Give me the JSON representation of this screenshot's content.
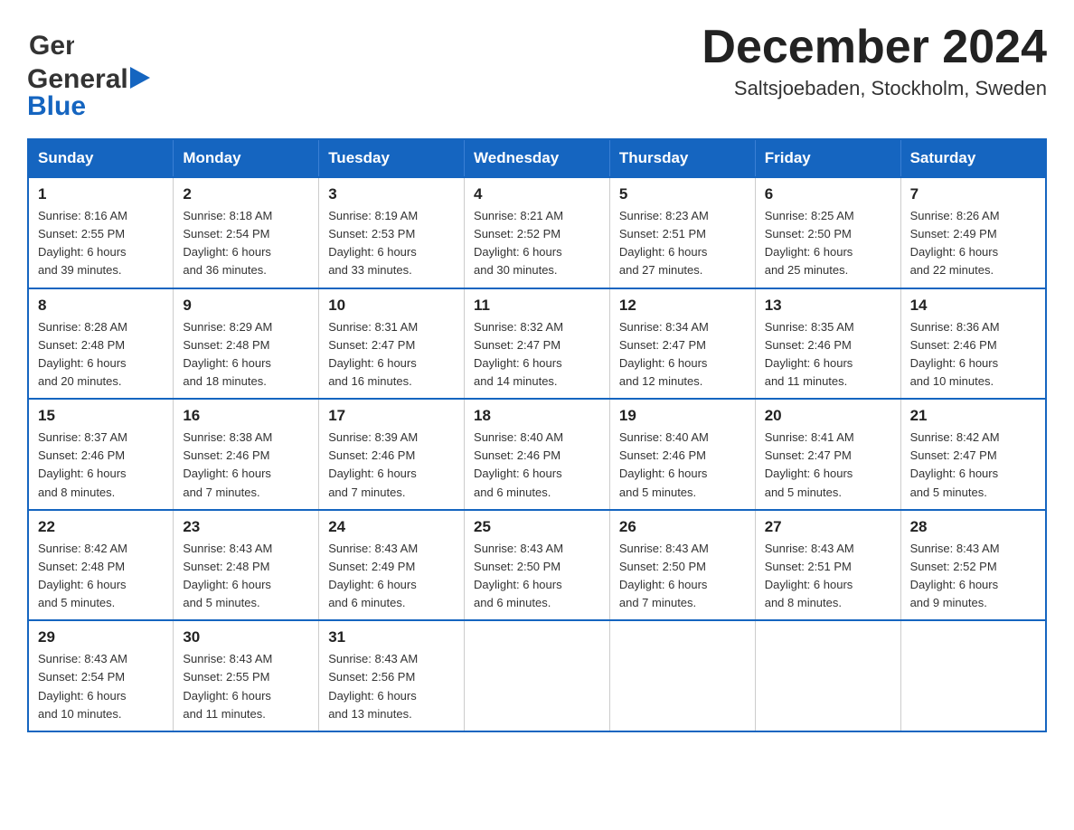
{
  "header": {
    "logo_line1": "General",
    "logo_line2": "Blue",
    "month_title": "December 2024",
    "subtitle": "Saltsjoebaden, Stockholm, Sweden"
  },
  "weekdays": [
    "Sunday",
    "Monday",
    "Tuesday",
    "Wednesday",
    "Thursday",
    "Friday",
    "Saturday"
  ],
  "weeks": [
    [
      {
        "day": "1",
        "sunrise": "8:16 AM",
        "sunset": "2:55 PM",
        "daylight": "6 hours and 39 minutes."
      },
      {
        "day": "2",
        "sunrise": "8:18 AM",
        "sunset": "2:54 PM",
        "daylight": "6 hours and 36 minutes."
      },
      {
        "day": "3",
        "sunrise": "8:19 AM",
        "sunset": "2:53 PM",
        "daylight": "6 hours and 33 minutes."
      },
      {
        "day": "4",
        "sunrise": "8:21 AM",
        "sunset": "2:52 PM",
        "daylight": "6 hours and 30 minutes."
      },
      {
        "day": "5",
        "sunrise": "8:23 AM",
        "sunset": "2:51 PM",
        "daylight": "6 hours and 27 minutes."
      },
      {
        "day": "6",
        "sunrise": "8:25 AM",
        "sunset": "2:50 PM",
        "daylight": "6 hours and 25 minutes."
      },
      {
        "day": "7",
        "sunrise": "8:26 AM",
        "sunset": "2:49 PM",
        "daylight": "6 hours and 22 minutes."
      }
    ],
    [
      {
        "day": "8",
        "sunrise": "8:28 AM",
        "sunset": "2:48 PM",
        "daylight": "6 hours and 20 minutes."
      },
      {
        "day": "9",
        "sunrise": "8:29 AM",
        "sunset": "2:48 PM",
        "daylight": "6 hours and 18 minutes."
      },
      {
        "day": "10",
        "sunrise": "8:31 AM",
        "sunset": "2:47 PM",
        "daylight": "6 hours and 16 minutes."
      },
      {
        "day": "11",
        "sunrise": "8:32 AM",
        "sunset": "2:47 PM",
        "daylight": "6 hours and 14 minutes."
      },
      {
        "day": "12",
        "sunrise": "8:34 AM",
        "sunset": "2:47 PM",
        "daylight": "6 hours and 12 minutes."
      },
      {
        "day": "13",
        "sunrise": "8:35 AM",
        "sunset": "2:46 PM",
        "daylight": "6 hours and 11 minutes."
      },
      {
        "day": "14",
        "sunrise": "8:36 AM",
        "sunset": "2:46 PM",
        "daylight": "6 hours and 10 minutes."
      }
    ],
    [
      {
        "day": "15",
        "sunrise": "8:37 AM",
        "sunset": "2:46 PM",
        "daylight": "6 hours and 8 minutes."
      },
      {
        "day": "16",
        "sunrise": "8:38 AM",
        "sunset": "2:46 PM",
        "daylight": "6 hours and 7 minutes."
      },
      {
        "day": "17",
        "sunrise": "8:39 AM",
        "sunset": "2:46 PM",
        "daylight": "6 hours and 7 minutes."
      },
      {
        "day": "18",
        "sunrise": "8:40 AM",
        "sunset": "2:46 PM",
        "daylight": "6 hours and 6 minutes."
      },
      {
        "day": "19",
        "sunrise": "8:40 AM",
        "sunset": "2:46 PM",
        "daylight": "6 hours and 5 minutes."
      },
      {
        "day": "20",
        "sunrise": "8:41 AM",
        "sunset": "2:47 PM",
        "daylight": "6 hours and 5 minutes."
      },
      {
        "day": "21",
        "sunrise": "8:42 AM",
        "sunset": "2:47 PM",
        "daylight": "6 hours and 5 minutes."
      }
    ],
    [
      {
        "day": "22",
        "sunrise": "8:42 AM",
        "sunset": "2:48 PM",
        "daylight": "6 hours and 5 minutes."
      },
      {
        "day": "23",
        "sunrise": "8:43 AM",
        "sunset": "2:48 PM",
        "daylight": "6 hours and 5 minutes."
      },
      {
        "day": "24",
        "sunrise": "8:43 AM",
        "sunset": "2:49 PM",
        "daylight": "6 hours and 6 minutes."
      },
      {
        "day": "25",
        "sunrise": "8:43 AM",
        "sunset": "2:50 PM",
        "daylight": "6 hours and 6 minutes."
      },
      {
        "day": "26",
        "sunrise": "8:43 AM",
        "sunset": "2:50 PM",
        "daylight": "6 hours and 7 minutes."
      },
      {
        "day": "27",
        "sunrise": "8:43 AM",
        "sunset": "2:51 PM",
        "daylight": "6 hours and 8 minutes."
      },
      {
        "day": "28",
        "sunrise": "8:43 AM",
        "sunset": "2:52 PM",
        "daylight": "6 hours and 9 minutes."
      }
    ],
    [
      {
        "day": "29",
        "sunrise": "8:43 AM",
        "sunset": "2:54 PM",
        "daylight": "6 hours and 10 minutes."
      },
      {
        "day": "30",
        "sunrise": "8:43 AM",
        "sunset": "2:55 PM",
        "daylight": "6 hours and 11 minutes."
      },
      {
        "day": "31",
        "sunrise": "8:43 AM",
        "sunset": "2:56 PM",
        "daylight": "6 hours and 13 minutes."
      },
      null,
      null,
      null,
      null
    ]
  ],
  "labels": {
    "sunrise": "Sunrise:",
    "sunset": "Sunset:",
    "daylight": "Daylight:"
  }
}
